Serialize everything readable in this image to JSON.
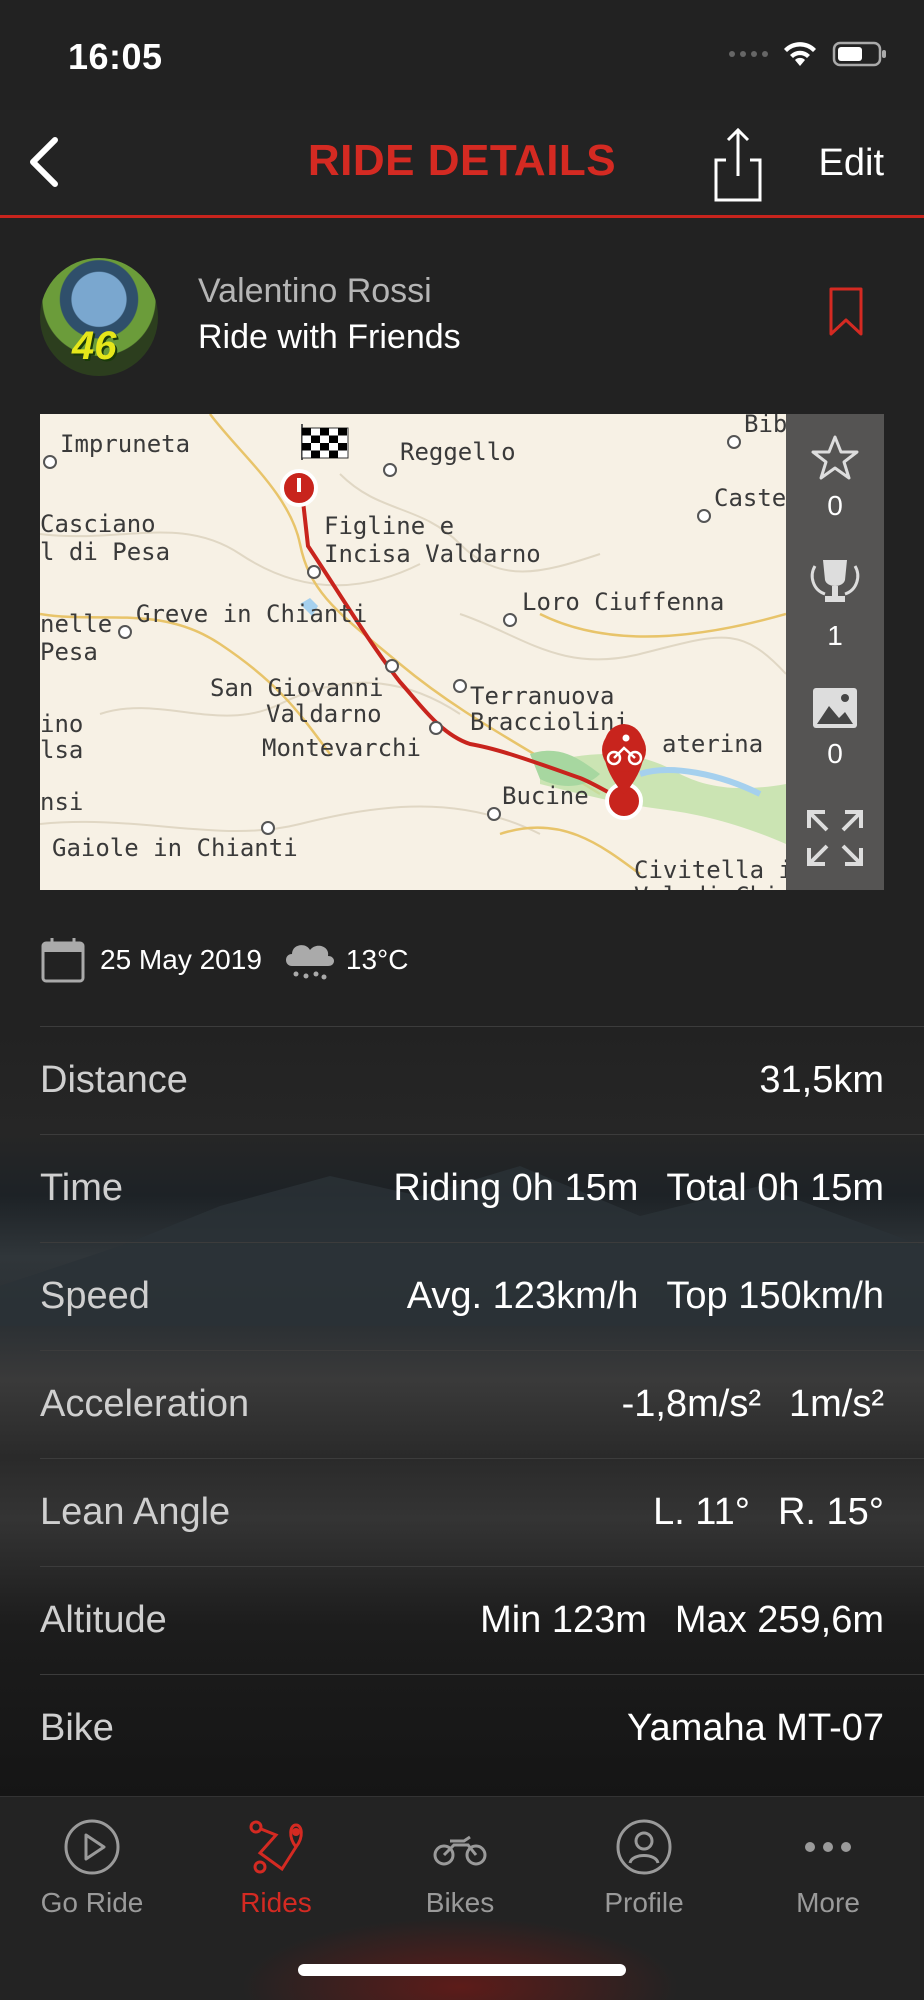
{
  "status_bar": {
    "time": "16:05"
  },
  "nav": {
    "title": "RIDE DETAILS",
    "edit_label": "Edit"
  },
  "ride": {
    "rider_name": "Valentino Rossi",
    "ride_name": "Ride with Friends",
    "avatar_number": "46"
  },
  "map": {
    "labels": {
      "impruneta": "Impruneta",
      "reggello": "Reggello",
      "bibbiena": "Bib",
      "castel": "Caste",
      "casciano1": "Casciano",
      "casciano2": "l di Pesa",
      "figline1": "Figline e",
      "figline2": "Incisa Valdarno",
      "loro": "Loro Ciuffenna",
      "nelle1": "nelle",
      "nelle2": "Pesa",
      "greve": "Greve in Chianti",
      "sangiovanni1": "San Giovanni",
      "sangiovanni2": "Valdarno",
      "montevarchi": "Montevarchi",
      "terranuova1": "Terranuova",
      "terranuova2": "Bracciolini",
      "laterina": "aterina",
      "ino1": "ino",
      "ino2": "lsa",
      "nsi": "nsi",
      "bucine": "Bucine",
      "gaiole": "Gaiole in Chianti",
      "civitella1": "Civitella in",
      "civitella2": "Val di Chiana"
    },
    "side": {
      "stars": "0",
      "trophies": "1",
      "photos": "0"
    }
  },
  "meta": {
    "date": "25 May 2019",
    "temperature": "13°C"
  },
  "stats": [
    {
      "label": "Distance",
      "values": [
        "31,5km"
      ]
    },
    {
      "label": "Time",
      "values": [
        "Riding 0h 15m",
        "Total 0h 15m"
      ]
    },
    {
      "label": "Speed",
      "values": [
        "Avg. 123km/h",
        "Top 150km/h"
      ]
    },
    {
      "label": "Acceleration",
      "values": [
        "-1,8m/s²",
        "1m/s²"
      ]
    },
    {
      "label": "Lean Angle",
      "values": [
        "L. 11°",
        "R. 15°"
      ]
    },
    {
      "label": "Altitude",
      "values": [
        "Min 123m",
        "Max 259,6m"
      ]
    },
    {
      "label": "Bike",
      "values": [
        "Yamaha MT-07"
      ]
    }
  ],
  "tabs": [
    {
      "label": "Go Ride"
    },
    {
      "label": "Rides"
    },
    {
      "label": "Bikes"
    },
    {
      "label": "Profile"
    },
    {
      "label": "More"
    }
  ],
  "colors": {
    "accent": "#d42a22",
    "background": "#222222",
    "route": "#c8241d"
  }
}
